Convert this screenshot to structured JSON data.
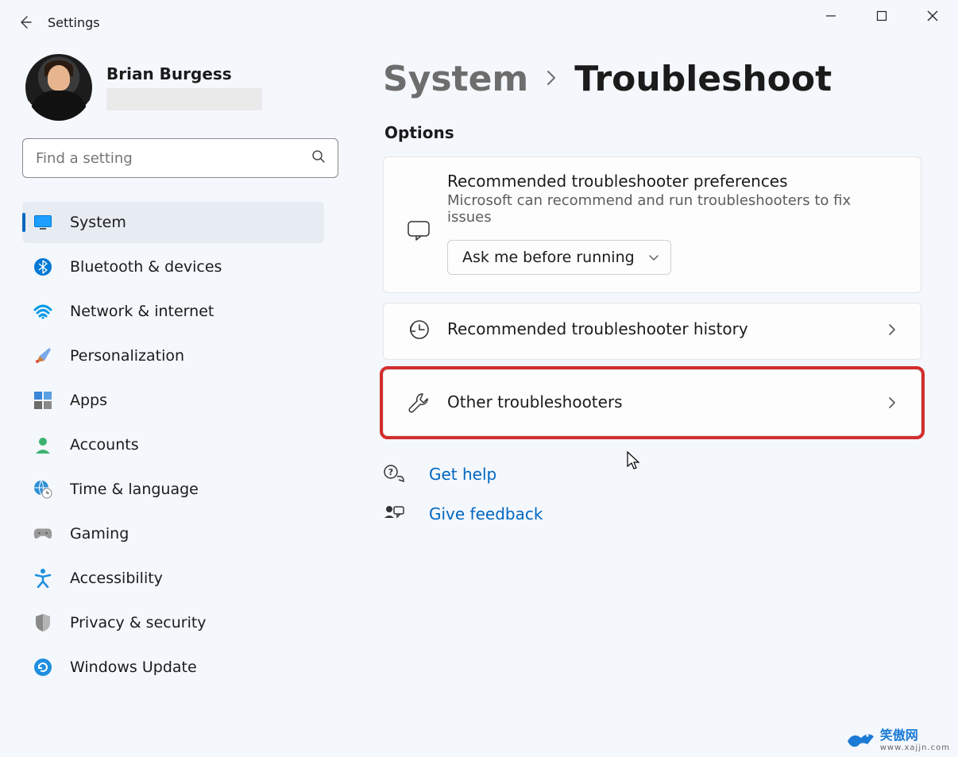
{
  "app": {
    "title": "Settings"
  },
  "profile": {
    "name": "Brian Burgess"
  },
  "search": {
    "placeholder": "Find a setting"
  },
  "sidebar": {
    "items": [
      {
        "label": "System"
      },
      {
        "label": "Bluetooth & devices"
      },
      {
        "label": "Network & internet"
      },
      {
        "label": "Personalization"
      },
      {
        "label": "Apps"
      },
      {
        "label": "Accounts"
      },
      {
        "label": "Time & language"
      },
      {
        "label": "Gaming"
      },
      {
        "label": "Accessibility"
      },
      {
        "label": "Privacy & security"
      },
      {
        "label": "Windows Update"
      }
    ]
  },
  "breadcrumb": {
    "parent": "System",
    "current": "Troubleshoot"
  },
  "options": {
    "heading": "Options",
    "preferences": {
      "title": "Recommended troubleshooter preferences",
      "desc": "Microsoft can recommend and run troubleshooters to fix issues",
      "dropdown_value": "Ask me before running"
    },
    "history": {
      "title": "Recommended troubleshooter history"
    },
    "other": {
      "title": "Other troubleshooters"
    }
  },
  "help": {
    "get_help": "Get help",
    "feedback": "Give feedback"
  },
  "watermark": {
    "text": "笑傲网",
    "sub": "www.xajjn.com"
  }
}
